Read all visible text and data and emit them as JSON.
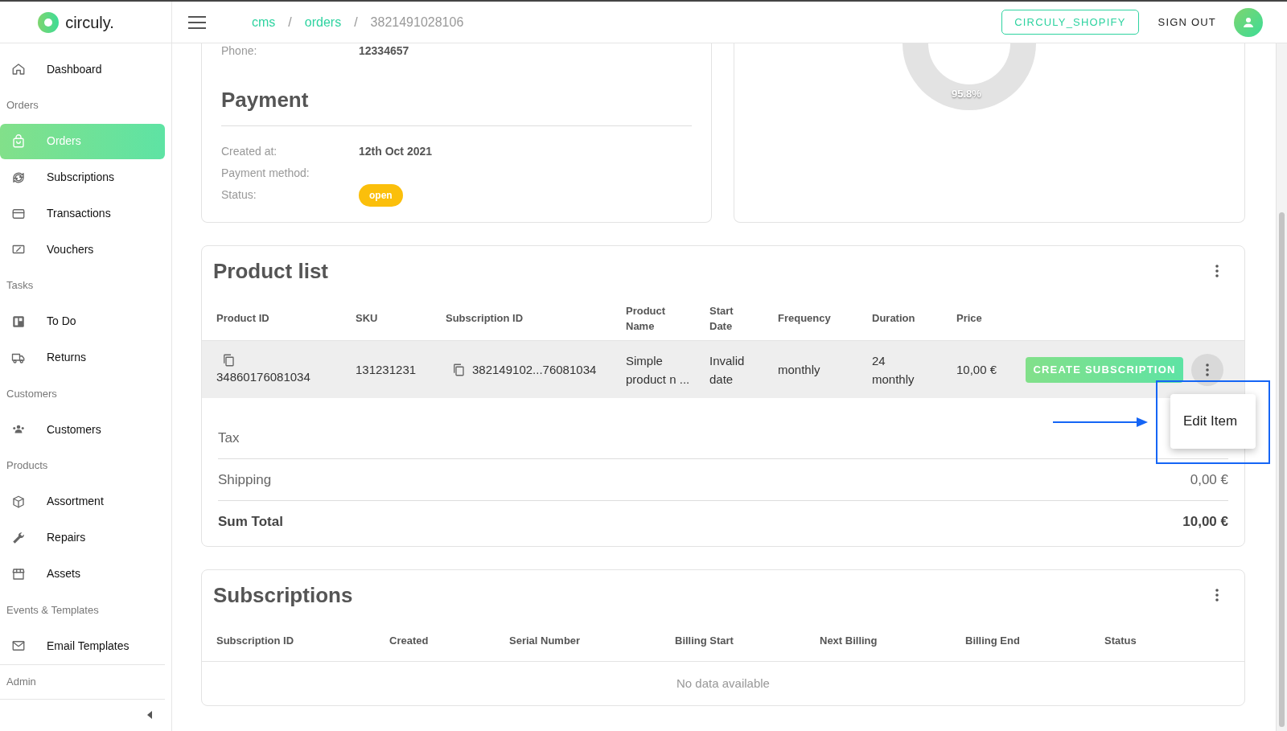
{
  "header": {
    "logo": "circuly.",
    "separator": "/",
    "breadcrumbs": [
      {
        "label": "cms",
        "link": true
      },
      {
        "label": "orders",
        "link": true
      },
      {
        "label": "3821491028106",
        "link": false
      }
    ],
    "shop_button": "CIRCULY_SHOPIFY",
    "sign_out": "SIGN OUT"
  },
  "sidebar": {
    "items": [
      {
        "kind": "link",
        "label": "Dashboard",
        "selected": false
      },
      {
        "kind": "section",
        "label": "Orders"
      },
      {
        "kind": "link",
        "label": "Orders",
        "selected": true
      },
      {
        "kind": "link",
        "label": "Subscriptions",
        "selected": false
      },
      {
        "kind": "link",
        "label": "Transactions",
        "selected": false
      },
      {
        "kind": "link",
        "label": "Vouchers",
        "selected": false
      },
      {
        "kind": "section",
        "label": "Tasks"
      },
      {
        "kind": "link",
        "label": "To Do",
        "selected": false
      },
      {
        "kind": "link",
        "label": "Returns",
        "selected": false
      },
      {
        "kind": "section",
        "label": "Customers"
      },
      {
        "kind": "link",
        "label": "Customers",
        "selected": false
      },
      {
        "kind": "section",
        "label": "Products"
      },
      {
        "kind": "link",
        "label": "Assortment",
        "selected": false
      },
      {
        "kind": "link",
        "label": "Repairs",
        "selected": false
      },
      {
        "kind": "link",
        "label": "Assets",
        "selected": false
      },
      {
        "kind": "section",
        "label": "Events & Templates"
      },
      {
        "kind": "link",
        "label": "Email Templates",
        "selected": false
      },
      {
        "kind": "divider_section",
        "label": "Admin"
      }
    ]
  },
  "payment_card": {
    "phone_label": "Phone:",
    "phone": "12334657",
    "title": "Payment",
    "fields": [
      {
        "label": "Created at:",
        "value": "12th Oct 2021"
      },
      {
        "label": "Payment method:"
      },
      {
        "label": "Status:",
        "badge": "open"
      }
    ]
  },
  "donut_card": {
    "label": "95.8%"
  },
  "product_list": {
    "title": "Product list",
    "columns": [
      "Product ID",
      "SKU",
      "Subscription ID",
      "Product Name",
      "Start Date",
      "Frequency",
      "Duration",
      "Price"
    ],
    "rows": [
      {
        "product_id": "34860176081034",
        "sku": "131231231",
        "subscription_id": "382149102...76081034",
        "product_name": "Simple product n ...",
        "start_date": "Invalid date",
        "frequency": "monthly",
        "duration": "24 monthly",
        "price": "10,00 €",
        "action": "CREATE SUBSCRIPTION"
      }
    ],
    "menu": [
      "Edit Item"
    ],
    "totals": [
      {
        "label": "Tax",
        "bold": false
      },
      {
        "label": "Shipping",
        "value": "0,00 €",
        "bold": false
      },
      {
        "label": "Sum Total",
        "value": "10,00 €",
        "bold": true
      }
    ]
  },
  "subscriptions": {
    "title": "Subscriptions",
    "columns": [
      "Subscription ID",
      "Created",
      "Serial Number",
      "Billing Start",
      "Next Billing",
      "Billing End",
      "Status"
    ],
    "empty": "No data available"
  }
}
